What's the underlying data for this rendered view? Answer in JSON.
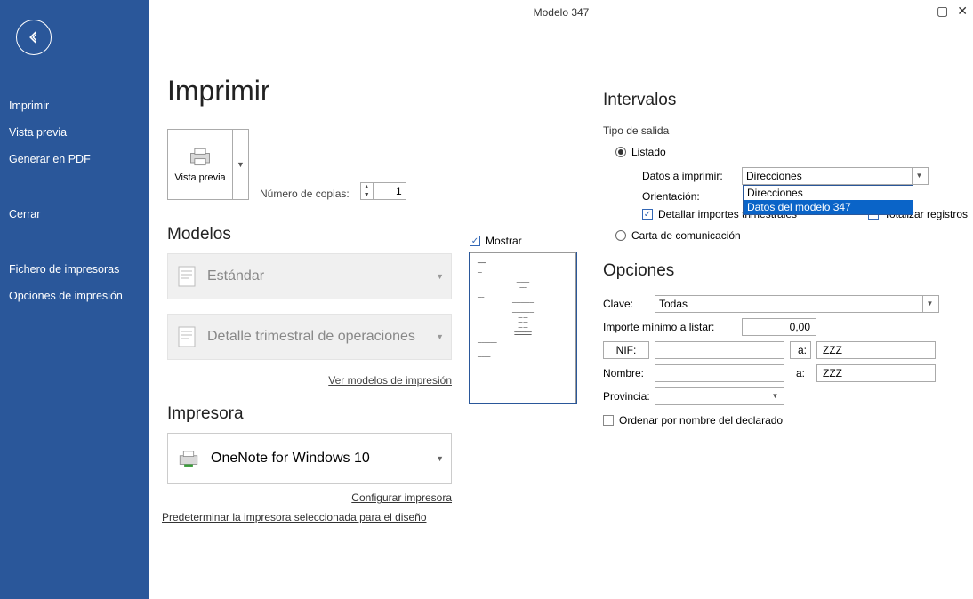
{
  "window": {
    "title": "Modelo 347"
  },
  "sidebar": {
    "items": [
      "Imprimir",
      "Vista previa",
      "Generar en PDF",
      "Cerrar",
      "Fichero de impresoras",
      "Opciones de impresión"
    ]
  },
  "print": {
    "heading": "Imprimir",
    "preview_btn": "Vista previa",
    "copies_label": "Número de copias:",
    "copies_value": "1"
  },
  "models": {
    "heading": "Modelos",
    "item1": "Estándar",
    "item2": "Detalle trimestral de operaciones",
    "link": "Ver modelos de impresión"
  },
  "showbox": {
    "mostrar": "Mostrar"
  },
  "printer": {
    "heading": "Impresora",
    "selected": "OneNote for Windows 10",
    "config": "Configurar impresora",
    "default": "Predeterminar la impresora seleccionada para el diseño"
  },
  "intervals": {
    "heading": "Intervalos",
    "tipo_salida": "Tipo de salida",
    "listado": "Listado",
    "datos_label": "Datos a imprimir:",
    "datos_value": "Direcciones",
    "datos_options": [
      "Direcciones",
      "Datos del modelo 347"
    ],
    "orient_label": "Orientación:",
    "detallar": "Detallar importes trimestrales",
    "totalizar": "Totalizar registros",
    "carta": "Carta de comunicación"
  },
  "options": {
    "heading": "Opciones",
    "clave_label": "Clave:",
    "clave_value": "Todas",
    "importe_label": "Importe mínimo a listar:",
    "importe_value": "0,00",
    "nif_label": "NIF:",
    "a_label": "a:",
    "zzz": "ZZZ",
    "nombre_label": "Nombre:",
    "provincia_label": "Provincia:",
    "ordenar": "Ordenar por nombre del declarado"
  }
}
